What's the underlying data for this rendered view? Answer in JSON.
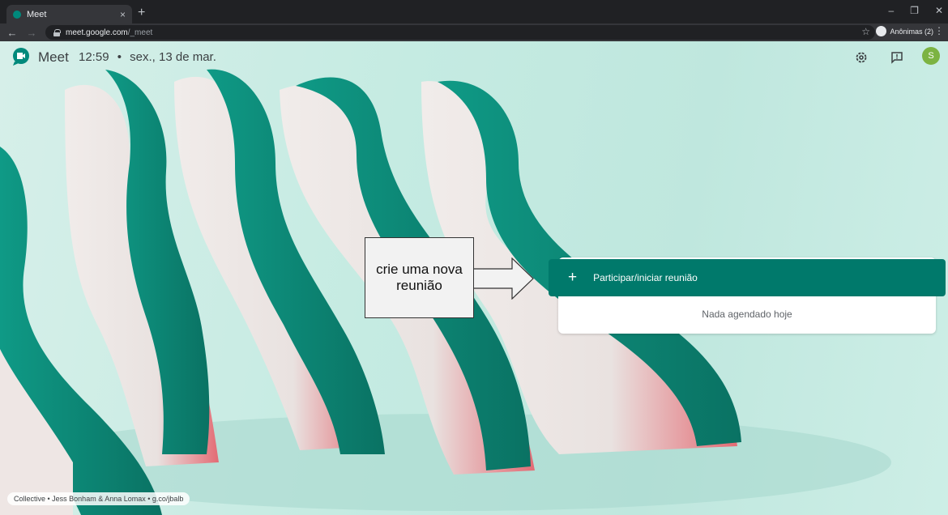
{
  "browser": {
    "tab_title": "Meet",
    "tab_close": "×",
    "new_tab": "+",
    "url_host": "meet.google.com",
    "url_path": "/_meet",
    "profile_label": "Anônimas (2)",
    "window_controls": [
      "–",
      "❐",
      "✕"
    ]
  },
  "header": {
    "brand": "Meet",
    "time": "12:59",
    "separator": "•",
    "date": "sex., 13 de mar.",
    "avatar_letter": "S",
    "icons": [
      "settings-icon",
      "feedback-icon"
    ]
  },
  "callout": {
    "text": "crie uma nova reunião"
  },
  "main": {
    "join_button_label": "Participar/iniciar reunião",
    "empty_schedule_text": "Nada agendado hoje"
  },
  "credits": {
    "text": "Collective • Jess Bonham & Anna Lomax • g.co/jbalb"
  },
  "colors": {
    "accent": "#00796b",
    "avatar": "#7cb342"
  }
}
